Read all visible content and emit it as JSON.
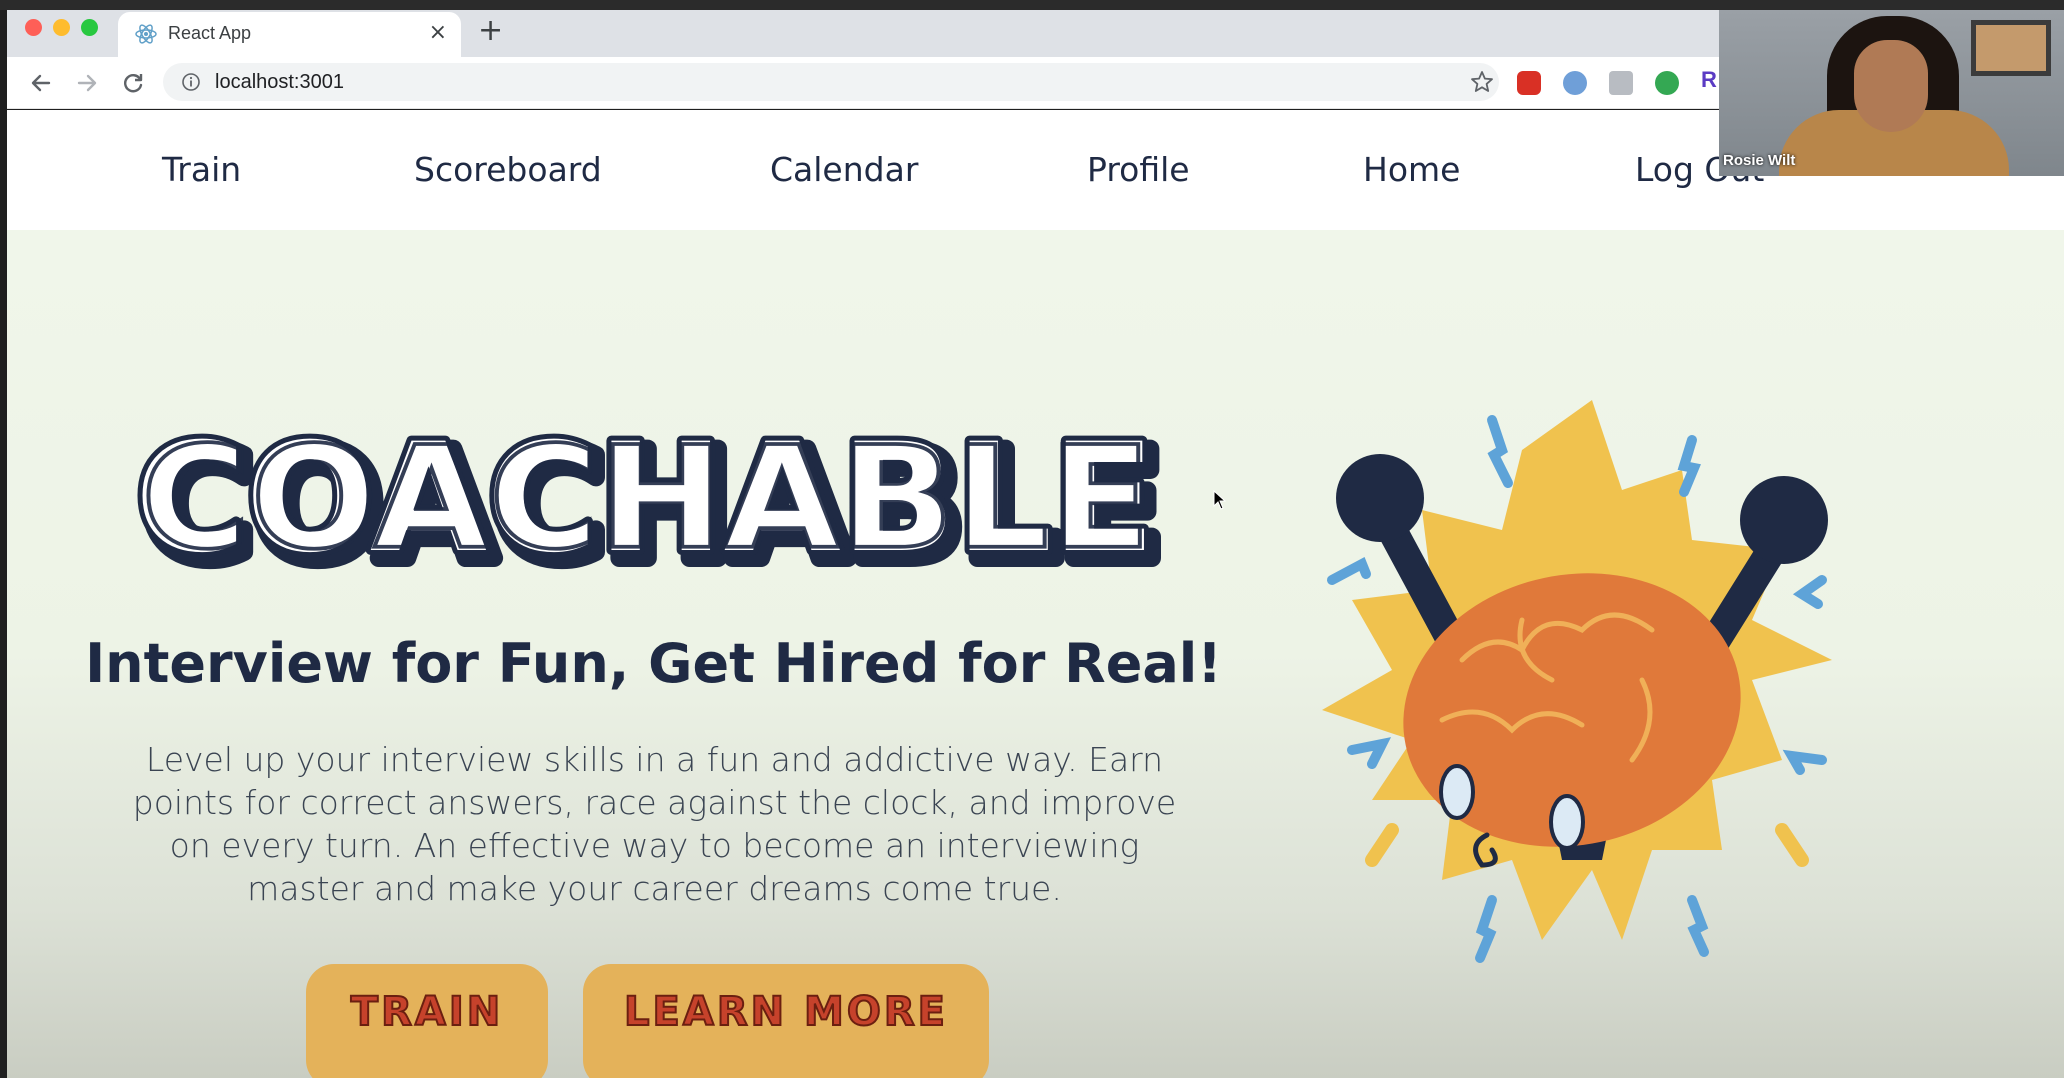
{
  "browser": {
    "tab_title": "React App",
    "tab_close": "×",
    "new_tab": "+",
    "url": "localhost:3001"
  },
  "navbar": {
    "links": [
      "Train",
      "Scoreboard",
      "Calendar",
      "Profile",
      "Home",
      "Log Out"
    ]
  },
  "hero": {
    "logo_text": "COACHABLE",
    "headline": "Interview for Fun, Get Hired for Real!",
    "subtext_lines": [
      "Level up your interview skills in a fun and addictive way. Earn",
      "points for correct answers, race against the clock, and improve",
      "on every turn. An effective way to become an interviewing",
      "master and make your career dreams come true."
    ],
    "buttons": {
      "train": "TRAIN",
      "learn_more": "LEARN MORE"
    }
  },
  "webcam": {
    "name": "Rosie Wilt"
  },
  "colors": {
    "navy": "#1f2a44",
    "hero_bg": "#f0f6ea",
    "button": "#e4b25a",
    "button_text": "#c6422b",
    "brain": "#e0793a",
    "burst": "#f0c24e",
    "sparks": "#5ea3d8"
  }
}
